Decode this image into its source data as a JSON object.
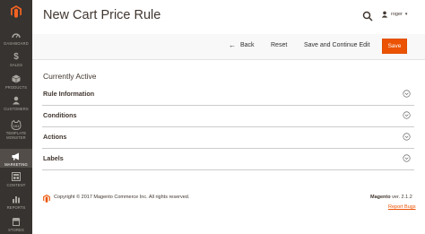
{
  "page": {
    "title": "New Cart Price Rule"
  },
  "header": {
    "user_name": "roger"
  },
  "sidebar": {
    "items": [
      {
        "label": "DASHBOARD",
        "icon": "dashboard-icon"
      },
      {
        "label": "SALES",
        "icon": "dollar-icon"
      },
      {
        "label": "PRODUCTS",
        "icon": "cube-icon"
      },
      {
        "label": "CUSTOMERS",
        "icon": "person-icon"
      },
      {
        "label": "TEMPLATE MONSTER",
        "icon": "tm-icon"
      },
      {
        "label": "MARKETING",
        "icon": "megaphone-icon",
        "active": true
      },
      {
        "label": "CONTENT",
        "icon": "layout-icon"
      },
      {
        "label": "REPORTS",
        "icon": "bar-chart-icon"
      },
      {
        "label": "STORES",
        "icon": "store-icon"
      }
    ]
  },
  "actions": {
    "back_label": "Back",
    "reset_label": "Reset",
    "save_continue_label": "Save and Continue Edit",
    "save_label": "Save"
  },
  "status": {
    "currently_active": "Currently Active"
  },
  "sections": [
    {
      "title": "Rule Information"
    },
    {
      "title": "Conditions"
    },
    {
      "title": "Actions"
    },
    {
      "title": "Labels"
    }
  ],
  "footer": {
    "copyright": "Copyright © 2017 Magento Commerce Inc. All rights reserved.",
    "brand": "Magento",
    "version": "ver. 2.1.2",
    "report_bugs": "Report Bugs"
  },
  "colors": {
    "accent": "#eb5202",
    "sidebar_bg": "#373330",
    "sidebar_active": "#524d49"
  }
}
